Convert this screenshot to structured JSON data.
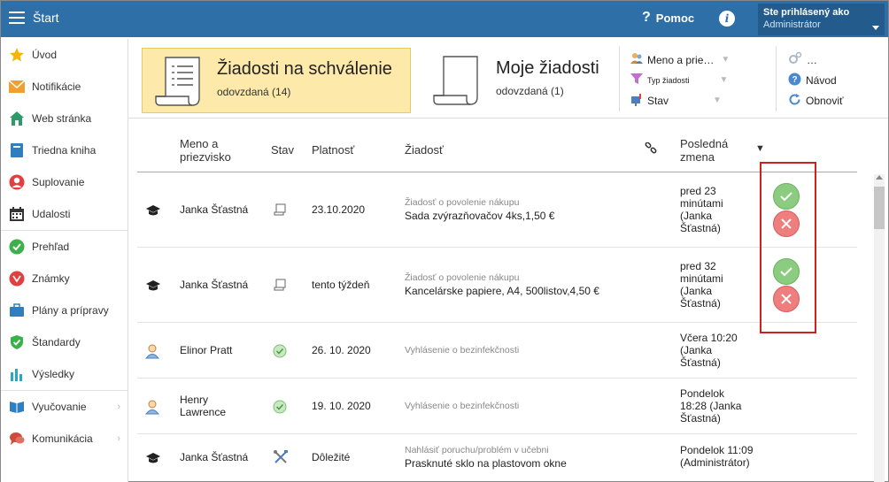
{
  "topbar": {
    "title": "Štart",
    "help_label": "Pomoc",
    "user_line1": "Ste prihlásený ako",
    "user_line2": "Administrátor"
  },
  "sidebar": {
    "items": [
      {
        "label": "Úvod",
        "icon": "star-icon",
        "color": "#f5b400"
      },
      {
        "label": "Notifikácie",
        "icon": "envelope-icon",
        "color": "#f0a030"
      },
      {
        "label": "Web stránka",
        "icon": "house-icon",
        "color": "#2e9a6a"
      },
      {
        "label": "Triedna kniha",
        "icon": "book-icon",
        "color": "#2f7fc0"
      },
      {
        "label": "Suplovanie",
        "icon": "person-icon",
        "color": "#e04040"
      },
      {
        "label": "Udalosti",
        "icon": "calendar-icon",
        "color": "#333333"
      },
      {
        "label": "Prehľad",
        "icon": "check-circle-icon",
        "color": "#3cb04a"
      },
      {
        "label": "Známky",
        "icon": "grade-icon",
        "color": "#e04040"
      },
      {
        "label": "Plány a prípravy",
        "icon": "briefcase-icon",
        "color": "#2f7fc0"
      },
      {
        "label": "Štandardy",
        "icon": "shield-icon",
        "color": "#3cb04a"
      },
      {
        "label": "Výsledky",
        "icon": "bar-chart-icon",
        "color": "#2aa7c7"
      },
      {
        "label": "Vyučovanie",
        "icon": "open-book-icon",
        "color": "#2f7fc0"
      },
      {
        "label": "Komunikácia",
        "icon": "chat-icon",
        "color": "#d04a3a"
      }
    ]
  },
  "filters": {
    "card1": {
      "title": "Žiadosti na schválenie",
      "sub": "odovzdaná (14)"
    },
    "card2": {
      "title": "Moje žiadosti",
      "sub": "odovzdaná (1)"
    },
    "name_filter": "Meno a prie…",
    "type_filter": "Typ žiadosti",
    "state_filter": "Stav",
    "more": "…",
    "guide": "Návod",
    "refresh": "Obnoviť"
  },
  "table": {
    "headers": {
      "name": "Meno a priezvisko",
      "state": "Stav",
      "validity": "Platnosť",
      "request": "Žiadosť",
      "last_change": "Posledná zmena",
      "sort": "▼"
    },
    "rows": [
      {
        "role": "teacher",
        "name": "Janka Šťastná",
        "state": "document",
        "validity": "23.10.2020",
        "type": "Žiadosť o povolenie nákupu",
        "desc": "Sada zvýrazňovačov 4ks,1,50 €",
        "change": "pred 23 minútami (Janka Šťastná)",
        "actions": true
      },
      {
        "role": "teacher",
        "name": "Janka Šťastná",
        "state": "document",
        "validity": "tento týždeň",
        "type": "Žiadosť o povolenie nákupu",
        "desc": "Kancelárske papiere, A4, 500listov,4,50 €",
        "change": "pred 32 minútami (Janka Šťastná)",
        "actions": true
      },
      {
        "role": "person",
        "name": "Elinor Pratt",
        "state": "approved",
        "validity": "26. 10. 2020",
        "type": "Vyhlásenie o bezinfekčnosti",
        "desc": "",
        "change": "Včera 10:20 (Janka Šťastná)",
        "actions": false
      },
      {
        "role": "person",
        "name": "Henry Lawrence",
        "state": "approved",
        "validity": "19. 10. 2020",
        "type": "Vyhlásenie o bezinfekčnosti",
        "desc": "",
        "change": "Pondelok 18:28 (Janka Šťastná)",
        "actions": false
      },
      {
        "role": "teacher",
        "name": "Janka Šťastná",
        "state": "tools",
        "validity": "Dôležité",
        "type": "Nahlásiť poruchu/problém v učebni",
        "desc": "Prasknuté sklo na plastovom okne",
        "change": "Pondelok 11:09 (Administrátor)",
        "actions": false
      }
    ]
  }
}
